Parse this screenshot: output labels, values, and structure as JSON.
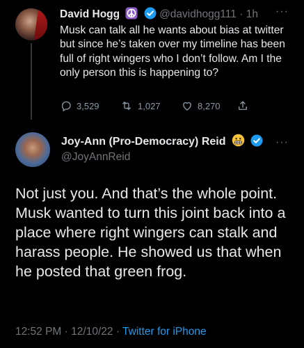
{
  "tweet1": {
    "display_name": "David Hogg",
    "handle": "@davidhogg111",
    "separator": "·",
    "time": "1h",
    "text": "Musk can talk all he wants about bias at twitter but since he’s taken over my timeline has been full of right wingers who I don’t follow. Am I the only person this is happening to?",
    "stats": {
      "replies": "3,529",
      "retweets": "1,027",
      "likes": "8,270"
    },
    "name_emoji_icon": "peace-sign-icon",
    "verified_color": "#1d9bf0"
  },
  "tweet2": {
    "display_name": "Joy-Ann (Pro-Democracy) Reid",
    "handle": "@JoyAnnReid",
    "name_emoji_icon": "grimacing-face-icon",
    "text": "Not just you. And that’s the whole point. Musk wanted to turn this joint back into a place where right wingers can stalk and harass people. He showed us that when he posted that green frog.",
    "time": "12:52 PM",
    "separator1": "·",
    "date": "12/10/22",
    "separator2": "·",
    "source": "Twitter for iPhone"
  },
  "colors": {
    "background": "#000000",
    "text": "#e7e9ea",
    "muted": "#71767b",
    "accent": "#1d9bf0"
  }
}
